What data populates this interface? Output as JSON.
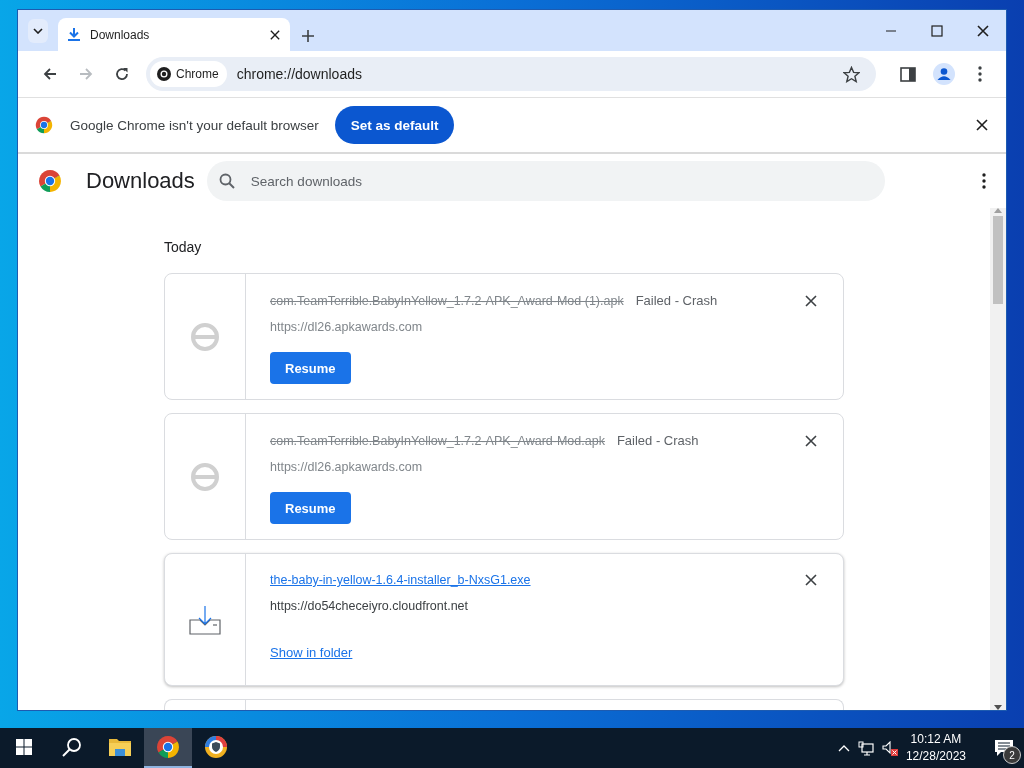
{
  "tab_strip": {
    "tabs": [
      {
        "title": "Downloads",
        "selected": true
      }
    ]
  },
  "toolbar": {
    "site_chip": "Chrome",
    "url": "chrome://downloads"
  },
  "infobar": {
    "message": "Google Chrome isn't your default browser",
    "button": "Set as default"
  },
  "header": {
    "title": "Downloads",
    "search_placeholder": "Search downloads"
  },
  "downloads": {
    "group": "Today",
    "items": [
      {
        "kind": "failed",
        "name": "com.TeamTerrible.BabyInYellow_1.7.2-APK_Award-Mod (1).apk",
        "status": "Failed - Crash",
        "url": "https://dl26.apkawards.com",
        "action": "Resume"
      },
      {
        "kind": "failed",
        "name": "com.TeamTerrible.BabyInYellow_1.7.2-APK_Award-Mod.apk",
        "status": "Failed - Crash",
        "url": "https://dl26.apkawards.com",
        "action": "Resume"
      },
      {
        "kind": "complete",
        "name": "the-baby-in-yellow-1.6.4-installer_b-NxsG1.exe",
        "url": "https://do54checeiyro.cloudfront.net",
        "action": "Show in folder"
      },
      {
        "kind": "partial"
      }
    ]
  },
  "taskbar": {
    "apps": [
      {
        "kind": "explorer",
        "selected": false
      },
      {
        "kind": "chrome",
        "selected": true
      },
      {
        "kind": "shield-browser",
        "selected": false
      }
    ],
    "time": "10:12 AM",
    "date": "12/28/2023",
    "notifications": "2"
  }
}
